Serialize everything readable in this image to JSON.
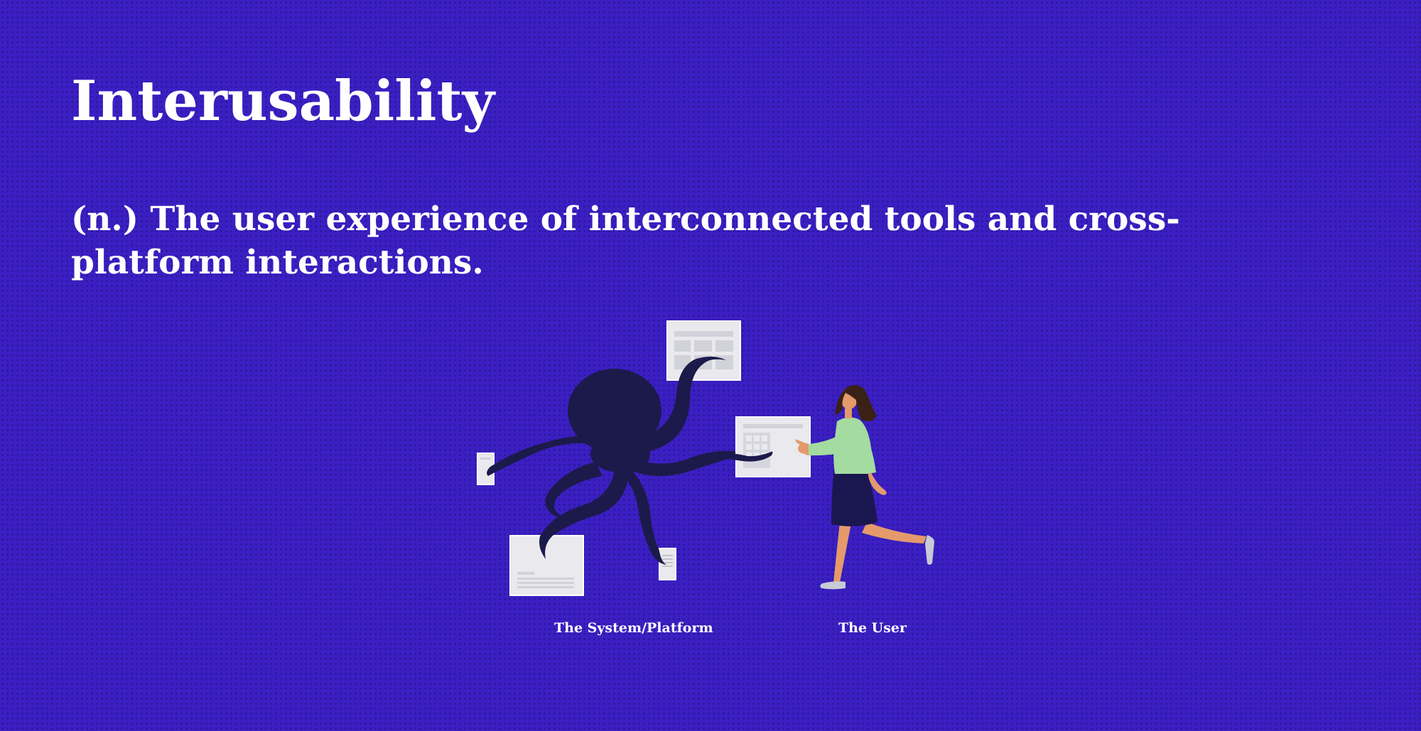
{
  "slide": {
    "title": "Interusability",
    "definition": "(n.) The user experience of interconnected tools and cross-platform interactions.",
    "background_color": "#3b1fc2"
  },
  "illustration": {
    "captions": {
      "system": "The System/Platform",
      "user": "The User"
    },
    "elements": {
      "octopus": "octopus-silhouette",
      "user": "woman-walking-carrying-window",
      "windows": "ui-window-card"
    },
    "colors": {
      "octopus": "#1c1a4a",
      "window_fill": "#e9e9ee",
      "window_border": "#ffffff",
      "shirt": "#a4dba0",
      "skirt": "#1a1750",
      "skin": "#e49a6a",
      "hair": "#3a2118",
      "shoes": "#c7cbd6"
    }
  }
}
